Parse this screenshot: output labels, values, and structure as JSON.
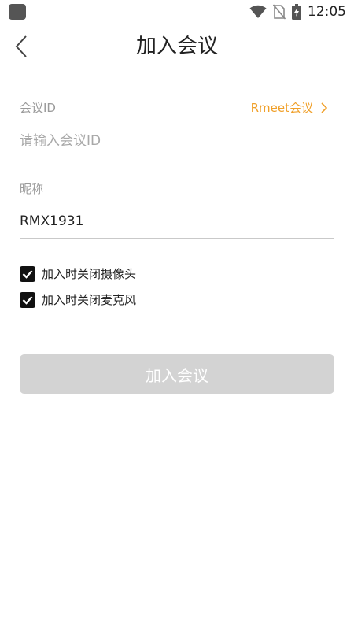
{
  "status_bar": {
    "time": "12:05",
    "icons": [
      "wifi-icon",
      "no-sim-icon",
      "battery-charging-icon"
    ]
  },
  "header": {
    "title": "加入会议",
    "back_icon": "chevron-left-icon"
  },
  "meeting_id": {
    "label": "会议ID",
    "placeholder": "请输入会议ID",
    "value": "",
    "link_label": "Rmeet会议",
    "link_icon": "chevron-right-icon"
  },
  "nickname": {
    "label": "昵称",
    "value": "RMX1931"
  },
  "options": [
    {
      "label": "加入时关闭摄像头",
      "checked": true
    },
    {
      "label": "加入时关闭麦克风",
      "checked": true
    }
  ],
  "join_button": {
    "label": "加入会议",
    "enabled": false
  },
  "colors": {
    "accent": "#f0a02a",
    "disabled_button": "#d3d3d3",
    "label_gray": "#9a9a9a",
    "divider": "#c9c9c9"
  }
}
